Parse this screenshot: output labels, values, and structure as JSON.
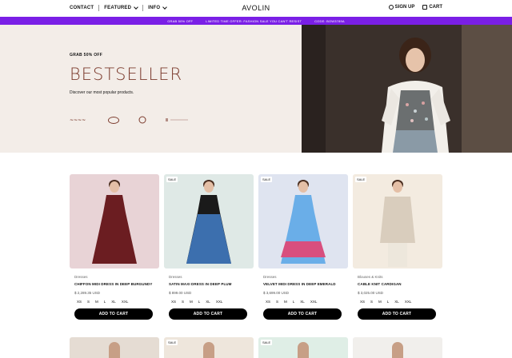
{
  "header": {
    "nav_left": [
      {
        "label": "CONTACT",
        "dropdown": false
      },
      {
        "label": "FEATURED",
        "dropdown": true
      },
      {
        "label": "INFO",
        "dropdown": true
      }
    ],
    "brand": "AVOLIN",
    "sign_up": "SIGN UP",
    "cart": "CART"
  },
  "promo": {
    "items": [
      "GRAB 50% OFF",
      "LIMITED TIME OFFER: FASHION SALE YOU CAN'T RESIST",
      "CODE: BOW3789A"
    ],
    "color": "#7a1fe6"
  },
  "hero": {
    "eyebrow": "GRAB 50% OFF",
    "title": "BESTSELLER",
    "subtitle": "Discover our most popular products.",
    "logos": [
      "logo-1",
      "logo-2",
      "logo-3",
      "logo-4"
    ],
    "accent": "#7b3a2c"
  },
  "products": [
    {
      "category": "Dresses",
      "name": "CHIFFON MIDI DRESS IN DEEP BURGUNDY",
      "price": "$ 2,289.35 USD",
      "sale": false,
      "sizes": [
        "XS",
        "S",
        "M",
        "L",
        "XL",
        "XXL"
      ],
      "button": "ADD TO CART",
      "bg": "#e8d3d6",
      "dress": "#6b1d21"
    },
    {
      "category": "Dresses",
      "name": "SATIN MAXI DRESS IN DEEP PLUM",
      "price": "$ 899.00 USD",
      "sale": true,
      "sale_label": "SALE",
      "sizes": [
        "XS",
        "S",
        "M",
        "L",
        "XL",
        "XXL"
      ],
      "button": "ADD TO CART",
      "bg": "#dfe9e6",
      "dress": "#1a1a1a"
    },
    {
      "category": "Dresses",
      "name": "VELVET MIDI DRESS IN DEEP EMERALD",
      "price": "$ 3,699.00 USD",
      "sale": true,
      "sale_label": "SALE",
      "sizes": [
        "XS",
        "S",
        "M",
        "L",
        "XL",
        "XXL"
      ],
      "button": "ADD TO CART",
      "bg": "#dfe4f0",
      "dress": "#6aaee8"
    },
    {
      "category": "Blouses & Knits",
      "name": "CABLE KNIT CARDIGAN",
      "price": "$ 3,025.00 USD",
      "sale": true,
      "sale_label": "SALE",
      "sizes": [
        "XS",
        "S",
        "M",
        "L",
        "XL",
        "XXL"
      ],
      "button": "ADD TO CART",
      "bg": "#f3ebe0",
      "dress": "#d9cdbd"
    }
  ],
  "row2": [
    {
      "sale": false,
      "bg": "#e5dcd3"
    },
    {
      "sale": true,
      "sale_label": "SALE",
      "bg": "#eee6dc"
    },
    {
      "sale": true,
      "sale_label": "SALE",
      "bg": "#dfeee6"
    },
    {
      "sale": false,
      "bg": "#f1efec"
    }
  ]
}
